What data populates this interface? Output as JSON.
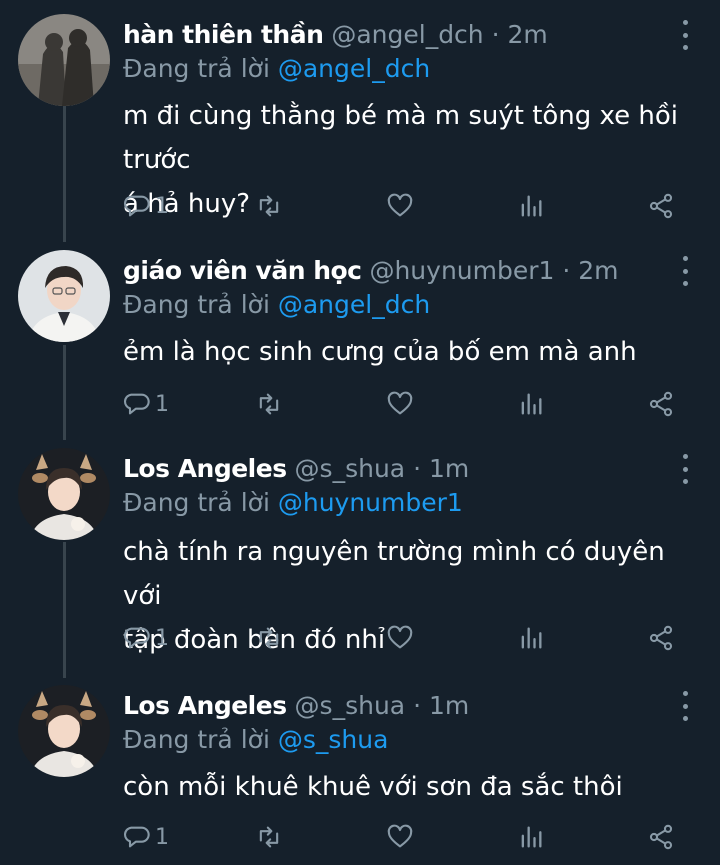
{
  "colors": {
    "background": "#15202b",
    "text_primary": "#ffffff",
    "text_secondary": "#8899a6",
    "mention": "#1d9bf0",
    "thread_line": "#38444d"
  },
  "tweets": [
    {
      "name": "hàn thiên thần",
      "handle": "@angel_dch",
      "separator": "·",
      "time": "2m",
      "reply_prefix": "Đang trả lời",
      "reply_to": "@angel_dch",
      "text_lines": [
        "m đi cùng thằng bé mà m suýt tông xe hồi trước",
        "á hả huy?"
      ],
      "reply_count": "1"
    },
    {
      "name": "giáo viên văn học",
      "handle": "@huynumber1",
      "separator": "·",
      "time": "2m",
      "reply_prefix": "Đang trả lời",
      "reply_to": "@angel_dch",
      "text_lines": [
        "ẻm là học sinh cưng của bố em mà anh"
      ],
      "reply_count": "1"
    },
    {
      "name": "Los Angeles",
      "handle": "@s_shua",
      "separator": "·",
      "time": "1m",
      "reply_prefix": "Đang trả lời",
      "reply_to": "@huynumber1",
      "text_lines": [
        "chà tính ra nguyên trường mình có duyên với",
        "tập đoàn bên đó nhỉ"
      ],
      "reply_count": "1"
    },
    {
      "name": "Los Angeles",
      "handle": "@s_shua",
      "separator": "·",
      "time": "1m",
      "reply_prefix": "Đang trả lời",
      "reply_to": "@s_shua",
      "text_lines": [
        "còn mỗi khuê khuê với sơn đa sắc thôi"
      ],
      "reply_count": "1"
    }
  ],
  "icons": {
    "reply": "reply-bubble-icon",
    "retweet": "retweet-icon",
    "like": "heart-icon",
    "analytics": "analytics-bars-icon",
    "share": "share-icon",
    "more": "more-vertical-icon"
  }
}
